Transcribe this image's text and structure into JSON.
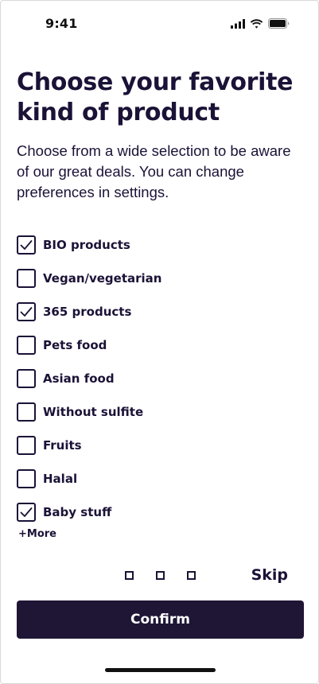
{
  "status_bar": {
    "time": "9:41"
  },
  "header": {
    "title": "Choose your favorite kind of product",
    "subtitle": "Choose from a wide selection to be aware of our great deals. You can change preferences in settings."
  },
  "options": [
    {
      "label": "BIO products",
      "checked": true
    },
    {
      "label": "Vegan/vegetarian",
      "checked": false
    },
    {
      "label": "365 products",
      "checked": true
    },
    {
      "label": "Pets food",
      "checked": false
    },
    {
      "label": "Asian food",
      "checked": false
    },
    {
      "label": "Without sulfite",
      "checked": false
    },
    {
      "label": "Fruits",
      "checked": false
    },
    {
      "label": "Halal",
      "checked": false
    },
    {
      "label": "Baby stuff",
      "checked": true
    }
  ],
  "more_label": "+More",
  "pager": {
    "pages": 3
  },
  "skip_label": "Skip",
  "confirm_label": "Confirm",
  "colors": {
    "text": "#1b1237",
    "button_bg": "#1f1535",
    "button_text": "#ffffff",
    "background": "#ffffff"
  }
}
